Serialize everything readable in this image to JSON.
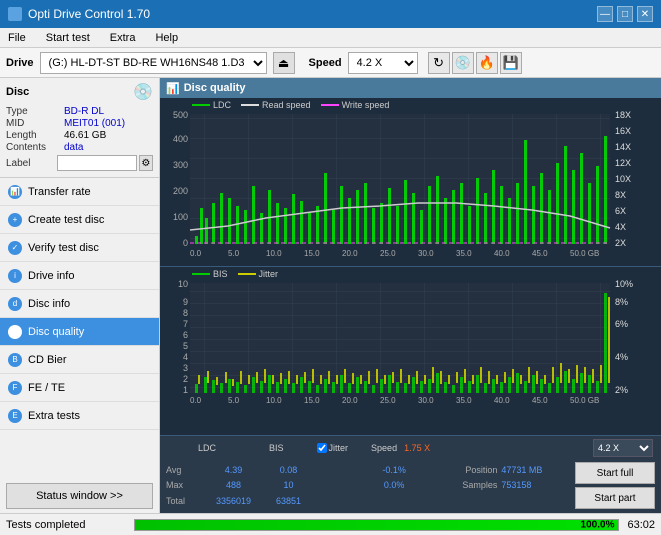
{
  "app": {
    "title": "Opti Drive Control 1.70",
    "icon": "disc"
  },
  "titlebar": {
    "minimize": "—",
    "maximize": "□",
    "close": "✕"
  },
  "menu": {
    "items": [
      "File",
      "Start test",
      "Extra",
      "Help"
    ]
  },
  "drivebar": {
    "drive_label": "Drive",
    "drive_value": "(G:)  HL-DT-ST BD-RE  WH16NS48 1.D3",
    "speed_label": "Speed",
    "speed_value": "4.2 X"
  },
  "disc": {
    "title": "Disc",
    "type_label": "Type",
    "type_value": "BD-R DL",
    "mid_label": "MID",
    "mid_value": "MEIT01 (001)",
    "length_label": "Length",
    "length_value": "46.61 GB",
    "contents_label": "Contents",
    "contents_value": "data",
    "label_label": "Label",
    "label_value": ""
  },
  "nav": {
    "items": [
      {
        "id": "transfer-rate",
        "label": "Transfer rate",
        "icon": "📊"
      },
      {
        "id": "create-test-disc",
        "label": "Create test disc",
        "icon": "💿"
      },
      {
        "id": "verify-test-disc",
        "label": "Verify test disc",
        "icon": "✔"
      },
      {
        "id": "drive-info",
        "label": "Drive info",
        "icon": "ℹ"
      },
      {
        "id": "disc-info",
        "label": "Disc info",
        "icon": "📀"
      },
      {
        "id": "disc-quality",
        "label": "Disc quality",
        "icon": "★",
        "active": true
      },
      {
        "id": "cd-bier",
        "label": "CD Bier",
        "icon": "🍺"
      },
      {
        "id": "fe-te",
        "label": "FE / TE",
        "icon": "📉"
      },
      {
        "id": "extra-tests",
        "label": "Extra tests",
        "icon": "🔬"
      }
    ]
  },
  "status_window": {
    "label": "Status window >>"
  },
  "chart": {
    "title": "Disc quality",
    "legend": {
      "ldc_label": "LDC",
      "ldc_color": "#00cc00",
      "read_label": "Read speed",
      "read_color": "#cccccc",
      "write_label": "Write speed",
      "write_color": "#ff44ff"
    },
    "top_y_left": [
      "500",
      "400",
      "300",
      "200",
      "100",
      "0"
    ],
    "top_y_right": [
      "18X",
      "16X",
      "14X",
      "12X",
      "10X",
      "8X",
      "6X",
      "4X",
      "2X"
    ],
    "x_labels": [
      "0.0",
      "5.0",
      "10.0",
      "15.0",
      "20.0",
      "25.0",
      "30.0",
      "35.0",
      "40.0",
      "45.0",
      "50.0 GB"
    ],
    "bottom_legend": {
      "bis_label": "BIS",
      "jitter_label": "Jitter"
    },
    "bottom_y_left": [
      "10",
      "9",
      "8",
      "7",
      "6",
      "5",
      "4",
      "3",
      "2",
      "1"
    ],
    "bottom_y_right": [
      "10%",
      "8%",
      "6%",
      "4%",
      "2%"
    ]
  },
  "stats": {
    "headers": [
      "LDC",
      "BIS",
      "",
      "Jitter",
      "Speed",
      ""
    ],
    "avg_label": "Avg",
    "avg_ldc": "4.39",
    "avg_bis": "0.08",
    "avg_jitter": "-0.1%",
    "max_label": "Max",
    "max_ldc": "488",
    "max_bis": "10",
    "max_jitter": "0.0%",
    "total_label": "Total",
    "total_ldc": "3356019",
    "total_bis": "63851",
    "speed_label": "Speed",
    "speed_value": "1.75 X",
    "speed_select": "4.2 X",
    "position_label": "Position",
    "position_value": "47731 MB",
    "samples_label": "Samples",
    "samples_value": "753158",
    "jitter_checked": true
  },
  "buttons": {
    "start_full": "Start full",
    "start_part": "Start part"
  },
  "statusbar": {
    "text": "Tests completed",
    "progress": 100,
    "progress_text": "100.0%",
    "right": "63:02"
  }
}
